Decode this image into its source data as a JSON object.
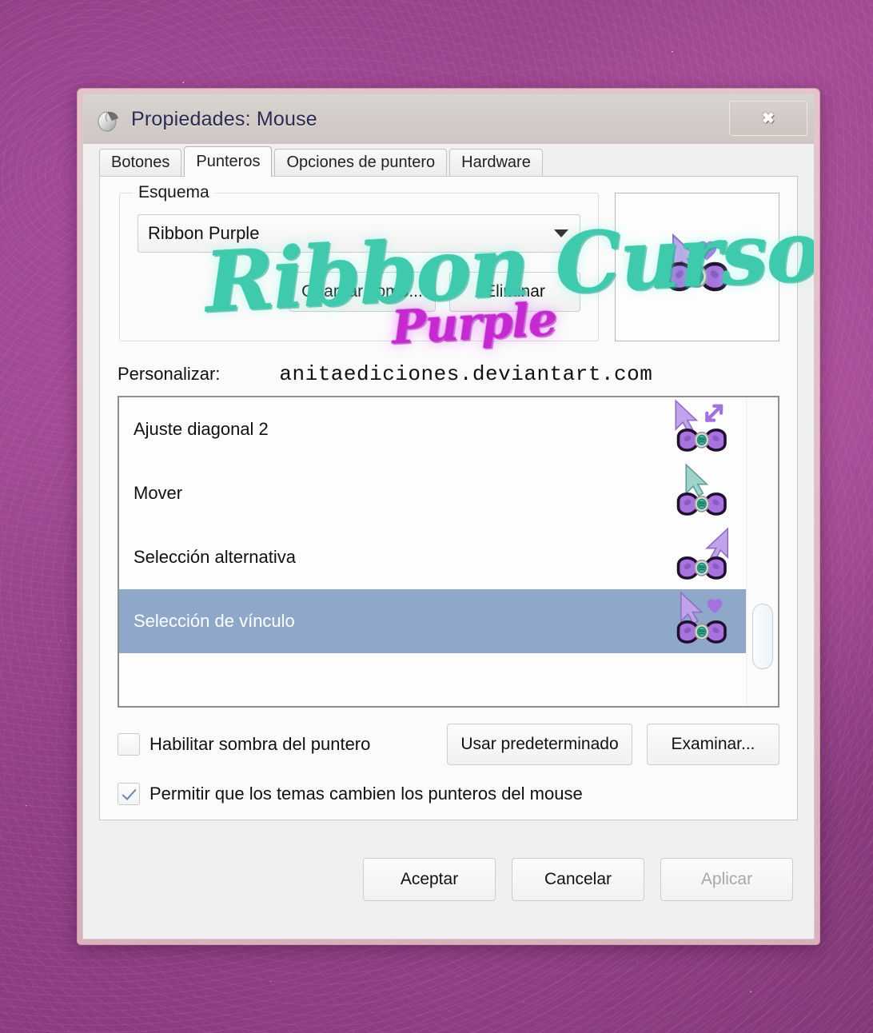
{
  "window": {
    "title": "Propiedades: Mouse",
    "icon": "mouse-icon",
    "close_label": "✖"
  },
  "tabs": [
    {
      "label": "Botones",
      "active": false
    },
    {
      "label": "Punteros",
      "active": true
    },
    {
      "label": "Opciones de puntero",
      "active": false
    },
    {
      "label": "Hardware",
      "active": false
    }
  ],
  "scheme": {
    "legend": "Esquema",
    "selected": "Ribbon Purple",
    "save_as_label": "Guardar como...",
    "delete_label": "Eliminar"
  },
  "customize": {
    "label": "Personalizar:",
    "watermark_url": "anitaediciones.deviantart.com",
    "rows": [
      {
        "label": "Ajuste diagonal 2",
        "cursor": "resize-diagonal-bow-cursor",
        "selected": false
      },
      {
        "label": "Mover",
        "cursor": "move-teal-arrow-bow-cursor",
        "selected": false
      },
      {
        "label": "Selección alternativa",
        "cursor": "alt-select-bow-cursor",
        "selected": false
      },
      {
        "label": "Selección de vínculo",
        "cursor": "link-select-heart-bow-cursor",
        "selected": true
      }
    ]
  },
  "options": {
    "shadow_label": "Habilitar sombra del puntero",
    "shadow_checked": false,
    "themes_label": "Permitir que los temas cambien los punteros del mouse",
    "themes_checked": true,
    "use_default_label": "Usar predeterminado",
    "browse_label": "Examinar..."
  },
  "footer": {
    "ok_label": "Aceptar",
    "cancel_label": "Cancelar",
    "apply_label": "Aplicar"
  },
  "watermark": {
    "title": "Ribbon Cursor",
    "subtitle": "Purple"
  },
  "colors": {
    "selection_blue": "#8fa8ca",
    "watermark_teal": "#3fc9ad",
    "watermark_magenta": "#c42ad0",
    "cursor_purple": "#b391e0",
    "cursor_bow": "#a46fd8",
    "cursor_teal": "#3fc9ad",
    "desktop_purple": "#913f86",
    "window_frame_pink": "#e6cdd0"
  }
}
